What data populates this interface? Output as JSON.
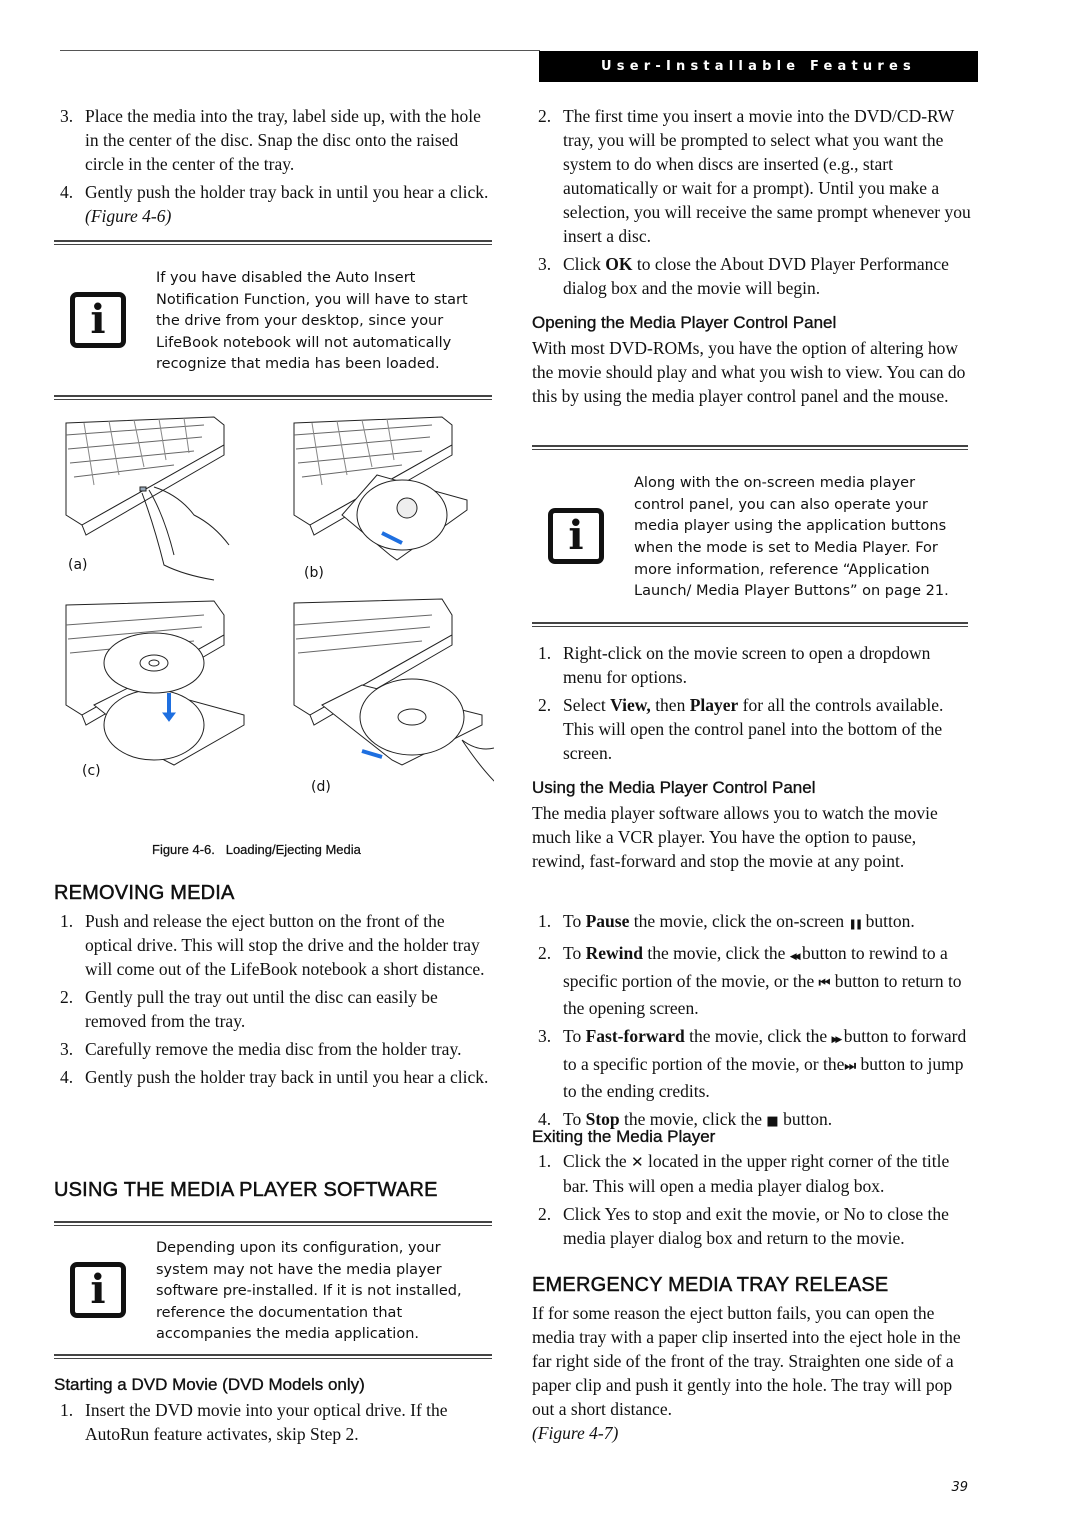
{
  "header": {
    "section_title": "User-Installable Features"
  },
  "left": {
    "intro_steps": [
      {
        "num": "3.",
        "text": "Place the media into the tray, label side up, with the hole in the center of the disc. Snap the disc onto the raised circle in the center of the tray."
      },
      {
        "num": "4.",
        "text": "Gently push the holder tray back in until you hear a click. ",
        "ref": "(Figure 4-6)"
      }
    ],
    "note1": {
      "icon": "info-icon",
      "icon_glyph": "i",
      "text": "If you have disabled the Auto Insert Notification Function, you will have to start the drive from your desktop, since your LifeBook notebook will not automatically recognize that media has been loaded."
    },
    "figure": {
      "panels": [
        {
          "label": "(a)",
          "desc": "finger pressing eject button"
        },
        {
          "label": "(b)",
          "desc": "tray sliding out"
        },
        {
          "label": "(c)",
          "desc": "disc placed onto spindle"
        },
        {
          "label": "(d)",
          "desc": "tray pushed back in"
        }
      ],
      "caption_num": "Figure 4-6.",
      "caption_text": "Loading/Ejecting Media",
      "arrow_color": "#1e6fe0"
    },
    "removing": {
      "heading": "REMOVING MEDIA",
      "steps": [
        {
          "num": "1.",
          "text": "Push and release the eject button on the front of the optical drive. This will stop the drive and the holder tray will come out of the LifeBook notebook a short distance."
        },
        {
          "num": "2.",
          "text": "Gently pull the tray out until the disc can easily be removed from the tray."
        },
        {
          "num": "3.",
          "text": "Carefully remove the media disc from the holder tray."
        },
        {
          "num": "4.",
          "text": "Gently push the holder tray back in until you hear a click."
        }
      ]
    },
    "software": {
      "heading": "USING THE MEDIA PLAYER SOFTWARE",
      "note": {
        "icon": "info-icon",
        "icon_glyph": "i",
        "text": "Depending upon its configuration, your system may not have the media player software pre-installed. If it is not installed, reference the documentation that accompanies the media application."
      }
    },
    "starting": {
      "heading": "Starting a DVD Movie (DVD Models only)",
      "steps": [
        {
          "num": "1.",
          "text": "Insert the DVD movie into your optical drive. If the AutoRun feature activates, skip Step 2."
        }
      ]
    }
  },
  "right": {
    "cont_steps": [
      {
        "num": "2.",
        "text": "The first time you insert a movie into the DVD/CD-RW tray, you will be prompted to select what you want the system to do when discs are inserted (e.g., start automatically or wait for a prompt). Until you make a selection, you will receive the same prompt whenever you insert a disc."
      },
      {
        "num": "3.",
        "pre": "Click ",
        "bold": "OK",
        "post": " to close the About DVD Player Performance dialog box and the movie will begin."
      }
    ],
    "opening": {
      "heading": "Opening the Media Player Control Panel",
      "para": "With most DVD-ROMs, you have the option of altering how the movie should play and what you wish to view. You can do this by using the media player control panel and the mouse.",
      "note": {
        "icon": "info-icon",
        "icon_glyph": "i",
        "text": "Along with the on-screen media player control panel, you can also operate your media player using the application buttons when the mode is set to Media Player. For more information, reference “Application Launch/ Media Player Buttons” on page 21."
      },
      "steps": [
        {
          "num": "1.",
          "text": "Right-click on the movie screen to open a dropdown menu for options."
        },
        {
          "num": "2.",
          "pre": "Select ",
          "bold1": "View,",
          "mid": " then ",
          "bold2": "Player",
          "post": "  for all the controls available. This will open the control panel into the bottom of the screen."
        }
      ]
    },
    "using": {
      "heading": "Using the Media Player Control Panel",
      "para": "The media player software allows you to watch the movie much like a VCR player. You have the option to pause, rewind, fast-forward and stop the movie at any point.",
      "steps": [
        {
          "num": "1.",
          "pre": "To ",
          "bold": "Pause",
          "mid": " the movie, click the on-screen ",
          "icon": "pause-icon",
          "glyph": "❚❚",
          "post": " button."
        },
        {
          "num": "2.",
          "pre": "To ",
          "bold": "Rewind",
          "mid": " the movie, click the ",
          "icon": "rewind-icon",
          "glyph": "◀◀",
          "mid2": " button to rewind to a specific portion of the movie, or the ",
          "icon2": "skip-back-icon",
          "glyph2": "⏮",
          "post": " button to return to the opening screen."
        },
        {
          "num": "3.",
          "pre": "To ",
          "bold": "Fast-forward",
          "mid": " the movie, click the ",
          "icon": "fast-forward-icon",
          "glyph": "▶▶",
          "mid2": " button to forward to a specific portion of the movie, or the",
          "icon2": "skip-forward-icon",
          "glyph2": "⏭",
          "post": " button to jump to the ending credits."
        },
        {
          "num": "4.",
          "pre": "To ",
          "bold": "Stop",
          "mid": " the movie, click the ",
          "icon": "stop-icon",
          "glyph": "■",
          "post": " button."
        }
      ]
    },
    "exiting": {
      "heading": "Exiting the Media Player",
      "steps": [
        {
          "num": "1.",
          "pre": "Click the ",
          "icon": "close-icon",
          "glyph": "✕",
          "post": " located in the upper right corner of the title bar. This will open a media player dialog box."
        },
        {
          "num": "2.",
          "text": "Click Yes to stop and exit the movie, or No to close the media player dialog box and return to the movie."
        }
      ]
    },
    "emergency": {
      "heading": "EMERGENCY MEDIA TRAY RELEASE",
      "para": "If for some reason the eject button fails, you can open the media tray with a paper clip inserted into the eject hole in the far right side of the front of the tray. Straighten one side of a paper clip and push it gently into the hole. The tray will pop out a short distance.",
      "ref": "(Figure 4-7)"
    }
  },
  "footer": {
    "page_number": "39"
  }
}
